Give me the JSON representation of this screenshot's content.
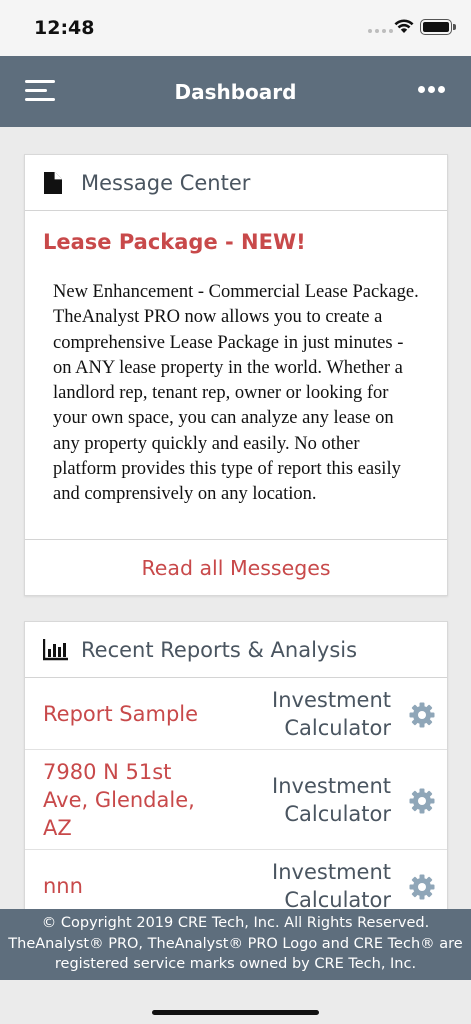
{
  "status_bar": {
    "time": "12:48"
  },
  "nav": {
    "title": "Dashboard"
  },
  "message_center": {
    "title": "Message Center",
    "message_title": "Lease Package - NEW!",
    "message_body": "New Enhancement - Commercial Lease Package. TheAnalyst PRO now allows you to create a comprehensive Lease Package in just minutes - on ANY lease property in the world. Whether a landlord rep, tenant rep, owner or looking for your own space, you can analyze any lease on any property quickly and easily. No other platform provides this type of report this easily and comprensively on any location.",
    "read_all_label": "Read all Messeges"
  },
  "recent_reports": {
    "title": "Recent Reports & Analysis",
    "items": [
      {
        "name": "Report Sample",
        "type": "Investment\nCalculator"
      },
      {
        "name": "7980 N 51st\nAve, Glendale,\nAZ",
        "type": "Investment\nCalculator"
      },
      {
        "name": "nnn",
        "type": "Investment\nCalculator"
      }
    ]
  },
  "footer": {
    "copyright": "© Copyright 2019 CRE Tech, Inc. All Rights Reserved. TheAnalyst® PRO, TheAnalyst® PRO Logo and CRE Tech® are registered service marks owned by CRE Tech, Inc."
  },
  "colors": {
    "nav": "#5e6e7d",
    "accent": "#c8494a",
    "text": "#4a5560"
  }
}
